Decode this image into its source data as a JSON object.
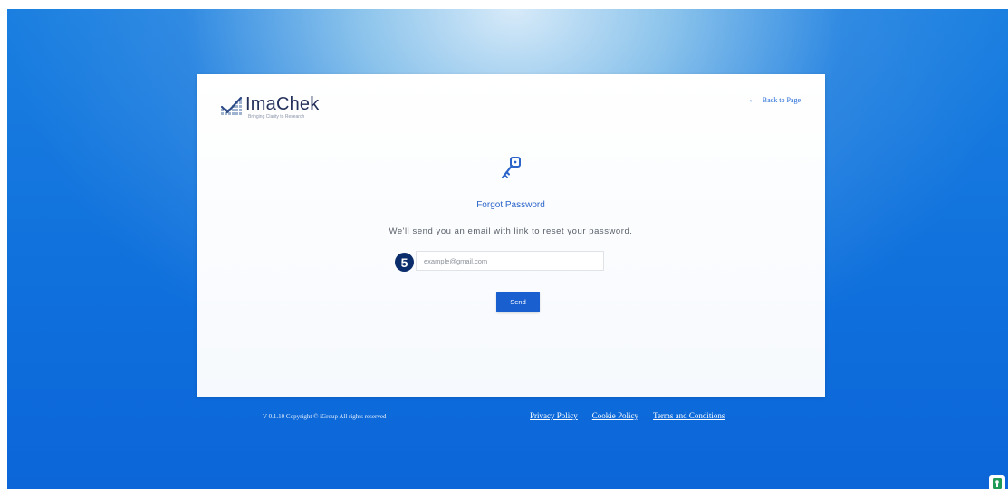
{
  "brand": {
    "name": "ImaChek",
    "tagline": "Bringing Clarity to Research",
    "logo_icon": "checkered-check-logo"
  },
  "nav": {
    "back_label": "Back to Page",
    "back_icon": "arrow-left-icon"
  },
  "form": {
    "icon": "key-icon",
    "title": "Forgot Password",
    "subtitle": "We'll send you an email with link to reset your password.",
    "step_badge": "5",
    "email_placeholder": "example@gmail.com",
    "email_value": "",
    "send_label": "Send"
  },
  "footer": {
    "copyright": "V 0.1.10 Copyright © iGroup All rights reserved",
    "links": [
      "Privacy Policy",
      "Cookie Policy",
      "Terms and Conditions"
    ]
  },
  "extension": {
    "icon": "password-manager-icon"
  },
  "colors": {
    "accent": "#1a5fd0",
    "title_blue": "#2b64c8",
    "brand_navy": "#23305a",
    "background_blue": "#0f6fdc",
    "badge_navy": "#0b2d6b"
  }
}
